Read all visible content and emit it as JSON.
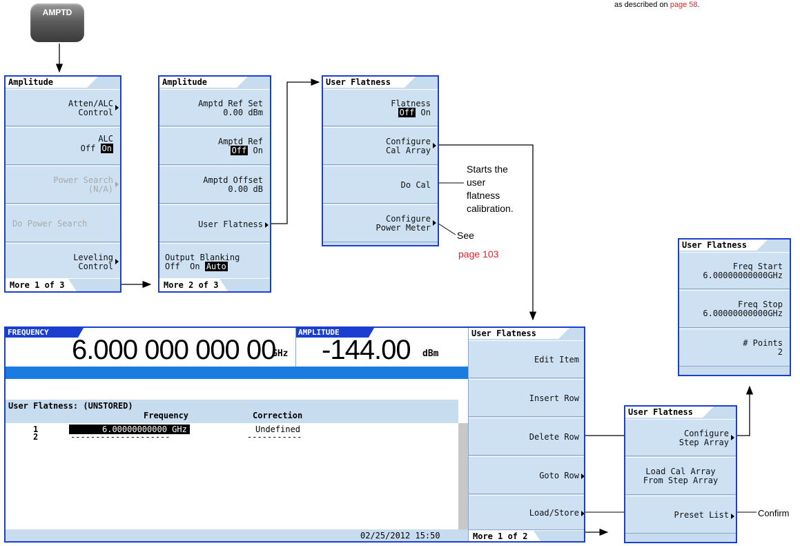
{
  "top_note": {
    "text": "as described on ",
    "page_ref": "page 58",
    "suffix": "."
  },
  "hardkey": {
    "label": "AMPTD"
  },
  "panel1": {
    "title": "Amplitude",
    "keys": [
      "Atten/ALC\nControl",
      "ALC",
      "Power Search\n(N/A)",
      "Do Power Search",
      "Leveling\nControl"
    ],
    "alc_off": "Off",
    "alc_on": "On",
    "more": "More 1 of 3"
  },
  "panel2": {
    "title": "Amplitude",
    "ref_set": "Amptd Ref Set",
    "ref_set_val": "0.00 dBm",
    "amptd_ref": "Amptd Ref",
    "off": "Off",
    "on": "On",
    "offset": "Amptd Offset",
    "offset_val": "0.00 dB",
    "user_flatness": "User Flatness",
    "blanking": "Output Blanking",
    "b_off": "Off",
    "b_on": "On",
    "b_auto": "Auto",
    "more": "More 2 of 3"
  },
  "panel3": {
    "title": "User Flatness",
    "flatness": "Flatness",
    "off": "Off",
    "on": "On",
    "configure_cal": "Configure\nCal Array",
    "do_cal": "Do Cal",
    "configure_pm": "Configure\nPower Meter"
  },
  "notes": {
    "starts": "Starts the\nuser\nflatness\ncalibration.",
    "see": "See",
    "page103": "page 103",
    "confirm": "Confirm"
  },
  "panel4": {
    "title": "User Flatness",
    "freq_start": "Freq Start",
    "freq_start_val": "6.00000000000GHz",
    "freq_stop": "Freq Stop",
    "freq_stop_val": "6.00000000000GHz",
    "points": "# Points",
    "points_val": "2"
  },
  "panel5": {
    "title": "User Flatness",
    "configure_step": "Configure\nStep Array",
    "load_cal": "Load Cal Array\nFrom Step Array",
    "preset_list": "Preset List"
  },
  "screen": {
    "freq_tag": "FREQUENCY",
    "freq_val": "6.000 000 000 00",
    "freq_unit": "GHz",
    "amp_tag": "AMPLITUDE",
    "amp_val": "-144.00",
    "amp_unit": "dBm",
    "table_title": "User Flatness: (UNSTORED)",
    "col_freq": "Frequency",
    "col_corr": "Correction",
    "row1_num": "1",
    "row1_freq": "6.00000000000 GHz",
    "row1_corr": "Undefined",
    "row2_num": "2",
    "row2_freq": "--------------------",
    "row2_corr": "-----------",
    "timestamp": "02/25/2012 15:50",
    "softkeys_title": "User Flatness",
    "softkeys": [
      "Edit Item",
      "Insert Row",
      "Delete Row",
      "Goto Row",
      "Load/Store"
    ],
    "more": "More 1 of 2"
  }
}
